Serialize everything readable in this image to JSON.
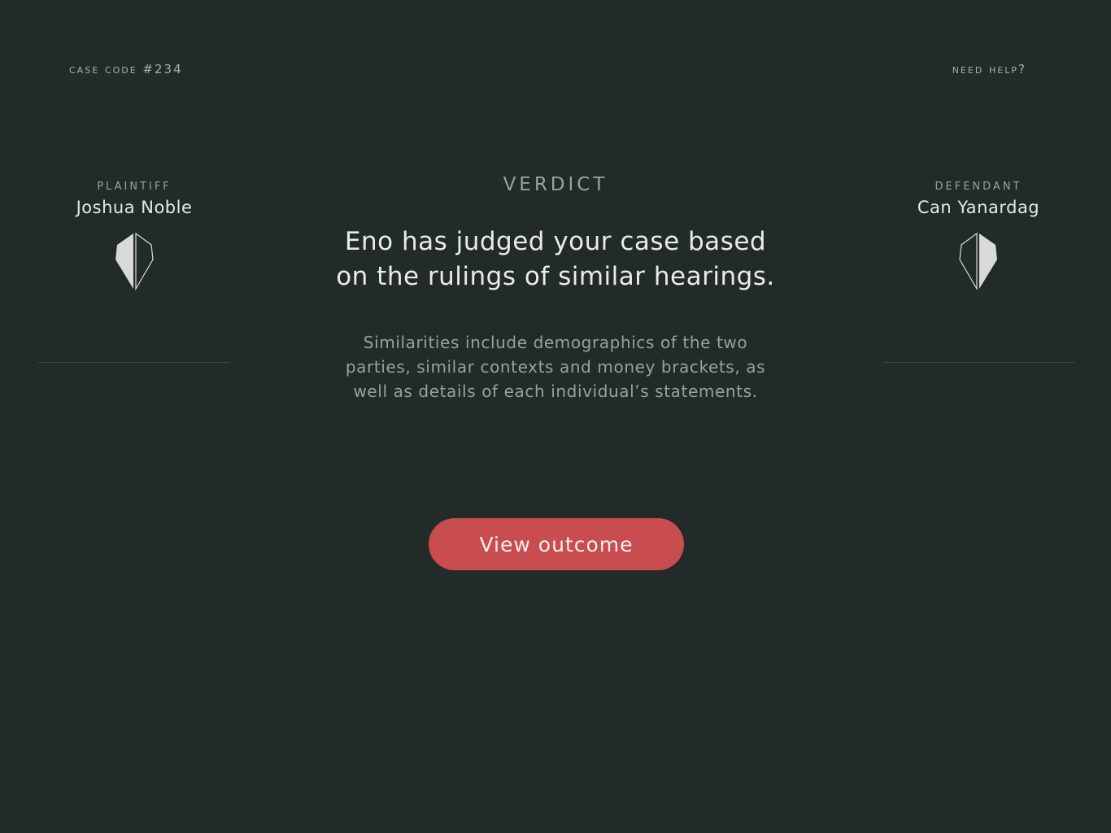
{
  "header": {
    "case_code": "Case Code #234",
    "help_link": "Need Help?"
  },
  "plaintiff": {
    "role": "Plaintiff",
    "name": "Joshua Noble",
    "icon": "half-diamond-left-filled-icon"
  },
  "defendant": {
    "role": "Defendant",
    "name": "Can Yanardag",
    "icon": "half-diamond-right-filled-icon"
  },
  "verdict": {
    "label": "VERDICT",
    "headline": "Eno has judged your case based on the rulings of similar hearings.",
    "details": "Similarities include demographics of the two parties, similar contexts and money brackets, as well as details of each individual’s statements."
  },
  "actions": {
    "view_outcome": "View outcome"
  },
  "colors": {
    "background": "#232a2a",
    "accent": "#c94d4f",
    "text_primary": "#e9ebe9",
    "text_secondary": "#9ba09e"
  }
}
